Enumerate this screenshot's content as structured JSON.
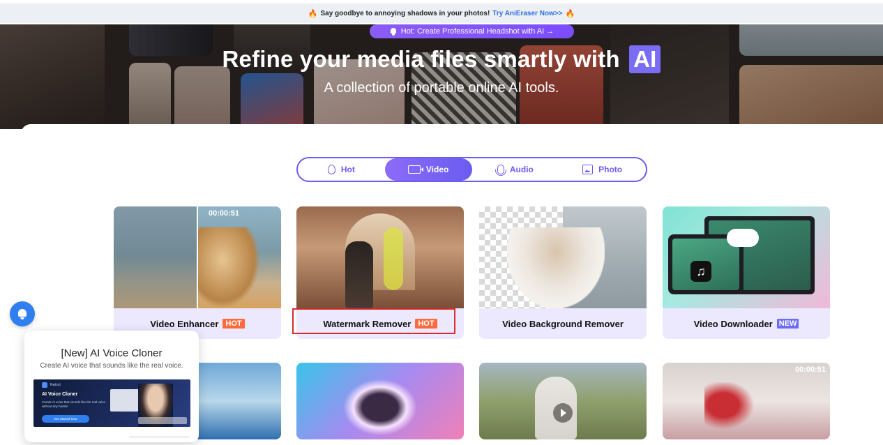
{
  "promo_banner": {
    "text": "Say goodbye to annoying shadows in your photos!",
    "link": "Try AniEraser Now>>",
    "icon": "fire-icon"
  },
  "hero": {
    "hot_pill": "Hot: Create Professional Headshot with AI →",
    "title": "Refine your media files smartly with",
    "title_highlight": "AI",
    "subtitle": "A collection of portable online AI tools."
  },
  "tabs": [
    {
      "label": "Hot",
      "icon": "flame-icon",
      "active": false
    },
    {
      "label": "Video",
      "icon": "video-camera-icon",
      "active": true
    },
    {
      "label": "Audio",
      "icon": "microphone-icon",
      "active": false
    },
    {
      "label": "Photo",
      "icon": "image-icon",
      "active": false
    }
  ],
  "cards": [
    {
      "title": "Video Enhancer",
      "badge": "HOT",
      "timestamp": "00:00:51"
    },
    {
      "title": "Watermark Remover",
      "badge": "HOT"
    },
    {
      "title": "Video Background Remover"
    },
    {
      "title": "Video Downloader",
      "badge": "NEW"
    },
    {
      "title": ""
    },
    {
      "title": ""
    },
    {
      "title": ""
    },
    {
      "title": "",
      "timestamp": "00:00:51"
    }
  ],
  "popup": {
    "title": "[New] AI Voice Cloner",
    "subtitle": "Create AI voice that sounds like the real voice.",
    "image": {
      "brand": "Kwicut",
      "title": "AI Voice Cloner",
      "description": "Create AI voice that sounds like the real voice without any hassle.",
      "button": "Get Started Now"
    }
  },
  "colors": {
    "accent": "#6d5cf0",
    "hot_badge": "#ff6a3d",
    "new_badge": "#6c6cf5",
    "link": "#2f6fe8",
    "highlight_border": "#d62c2c"
  }
}
